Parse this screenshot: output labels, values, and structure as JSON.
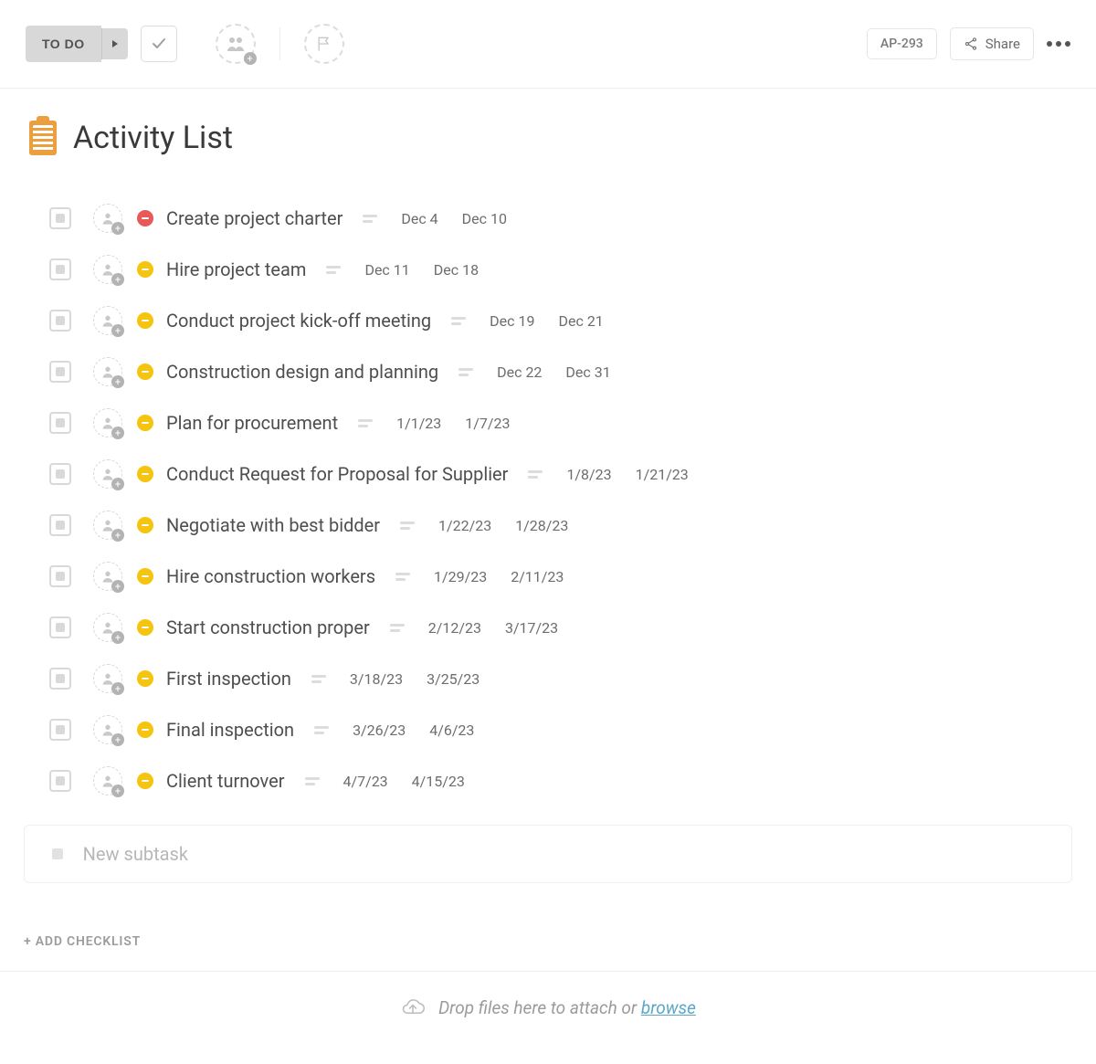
{
  "toolbar": {
    "status_label": "TO DO",
    "task_id": "AP-293",
    "share_label": "Share"
  },
  "page": {
    "title": "Activity List"
  },
  "tasks": [
    {
      "title": "Create project charter",
      "priority": "red",
      "start": "Dec 4",
      "end": "Dec 10"
    },
    {
      "title": "Hire project team",
      "priority": "yellow",
      "start": "Dec 11",
      "end": "Dec 18"
    },
    {
      "title": "Conduct project kick-off meeting",
      "priority": "yellow",
      "start": "Dec 19",
      "end": "Dec 21"
    },
    {
      "title": "Construction design and planning",
      "priority": "yellow",
      "start": "Dec 22",
      "end": "Dec 31"
    },
    {
      "title": "Plan for procurement",
      "priority": "yellow",
      "start": "1/1/23",
      "end": "1/7/23"
    },
    {
      "title": "Conduct Request for Proposal for Supplier",
      "priority": "yellow",
      "start": "1/8/23",
      "end": "1/21/23"
    },
    {
      "title": "Negotiate with best bidder",
      "priority": "yellow",
      "start": "1/22/23",
      "end": "1/28/23"
    },
    {
      "title": "Hire construction workers",
      "priority": "yellow",
      "start": "1/29/23",
      "end": "2/11/23"
    },
    {
      "title": "Start construction proper",
      "priority": "yellow",
      "start": "2/12/23",
      "end": "3/17/23"
    },
    {
      "title": "First inspection",
      "priority": "yellow",
      "start": "3/18/23",
      "end": "3/25/23"
    },
    {
      "title": "Final inspection",
      "priority": "yellow",
      "start": "3/26/23",
      "end": "4/6/23"
    },
    {
      "title": "Client turnover",
      "priority": "yellow",
      "start": "4/7/23",
      "end": "4/15/23"
    }
  ],
  "new_subtask": {
    "placeholder": "New subtask"
  },
  "add_checklist_label": "+ ADD CHECKLIST",
  "dropzone": {
    "text": "Drop files here to attach or ",
    "link": "browse"
  }
}
